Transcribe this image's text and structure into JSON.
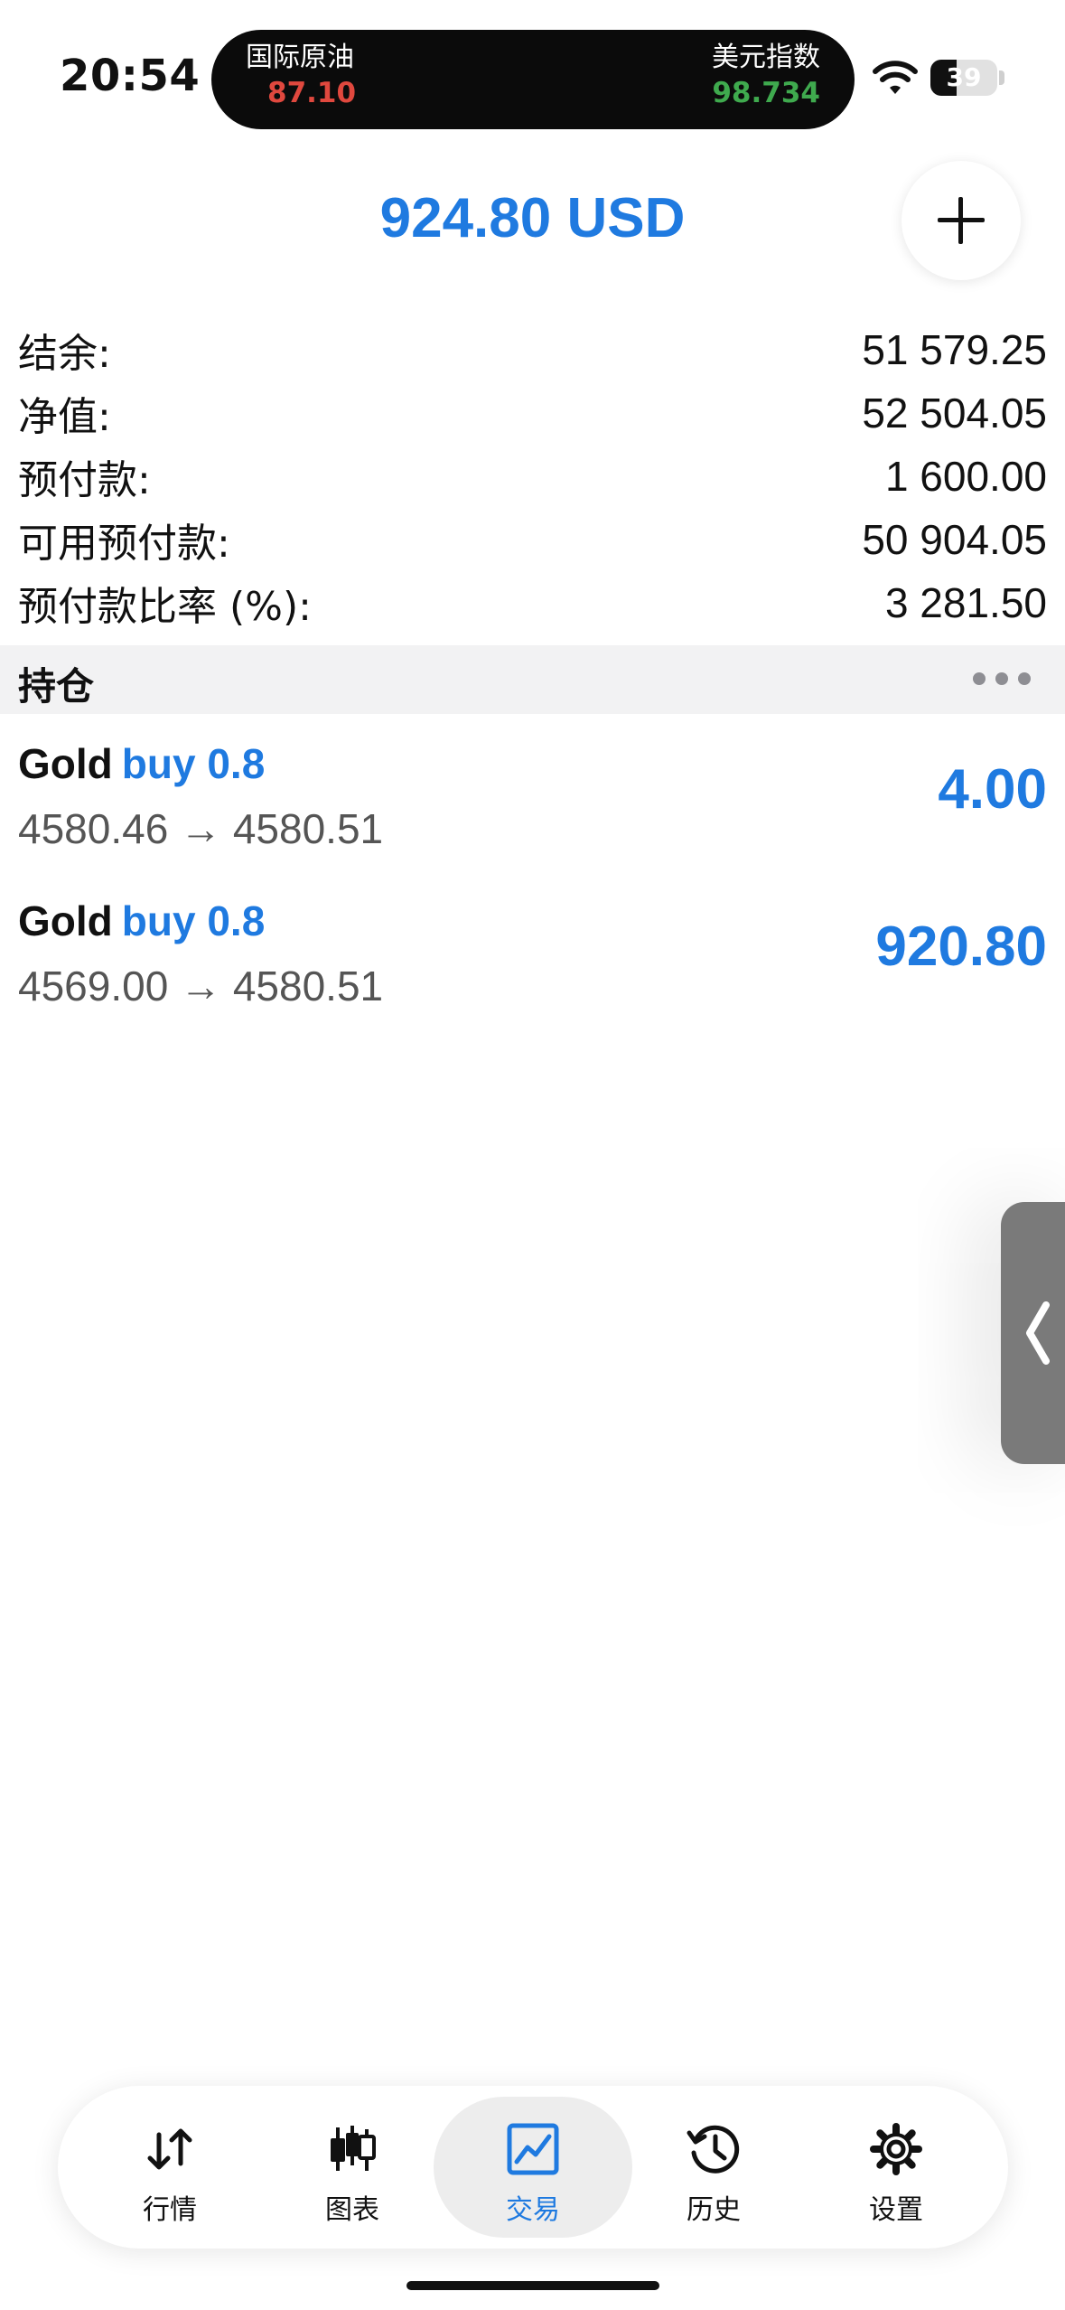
{
  "status_bar": {
    "time": "20:54",
    "tickers": [
      {
        "name": "国际原油",
        "value": "87.10",
        "color": "#e0483e"
      },
      {
        "name": "美元指数",
        "value": "98.734",
        "color": "#3faa4e"
      }
    ],
    "battery": {
      "level_percent": 39,
      "text": "39"
    }
  },
  "header": {
    "floating_profit": "924.80 USD",
    "add_icon": "plus-icon"
  },
  "account_summary": [
    {
      "label": "结余:",
      "value": "51 579.25"
    },
    {
      "label": "净值:",
      "value": "52 504.05"
    },
    {
      "label": "预付款:",
      "value": "1 600.00"
    },
    {
      "label": "可用预付款:",
      "value": "50 904.05"
    },
    {
      "label": "预付款比率 (%):",
      "value": "3 281.50"
    }
  ],
  "positions": {
    "title": "持仓",
    "more_icon": "more-horizontal-icon",
    "items": [
      {
        "symbol": "Gold",
        "side": "buy 0.8",
        "open_price": "4580.46",
        "arrow": "→",
        "current_price": "4580.51",
        "profit": "4.00"
      },
      {
        "symbol": "Gold",
        "side": "buy 0.8",
        "open_price": "4569.00",
        "arrow": "→",
        "current_price": "4580.51",
        "profit": "920.80"
      }
    ]
  },
  "side_handle": {
    "icon": "chevron-left-icon"
  },
  "tab_bar": {
    "active_index": 2,
    "tabs": [
      {
        "label": "行情",
        "icon": "quotes-arrows-icon"
      },
      {
        "label": "图表",
        "icon": "candlestick-chart-icon"
      },
      {
        "label": "交易",
        "icon": "trade-chart-icon"
      },
      {
        "label": "历史",
        "icon": "history-clock-icon"
      },
      {
        "label": "设置",
        "icon": "settings-gear-icon"
      }
    ]
  },
  "colors": {
    "accent_blue": "#1f7ae0",
    "loss_red": "#e0483e",
    "gain_green": "#3faa4e"
  }
}
